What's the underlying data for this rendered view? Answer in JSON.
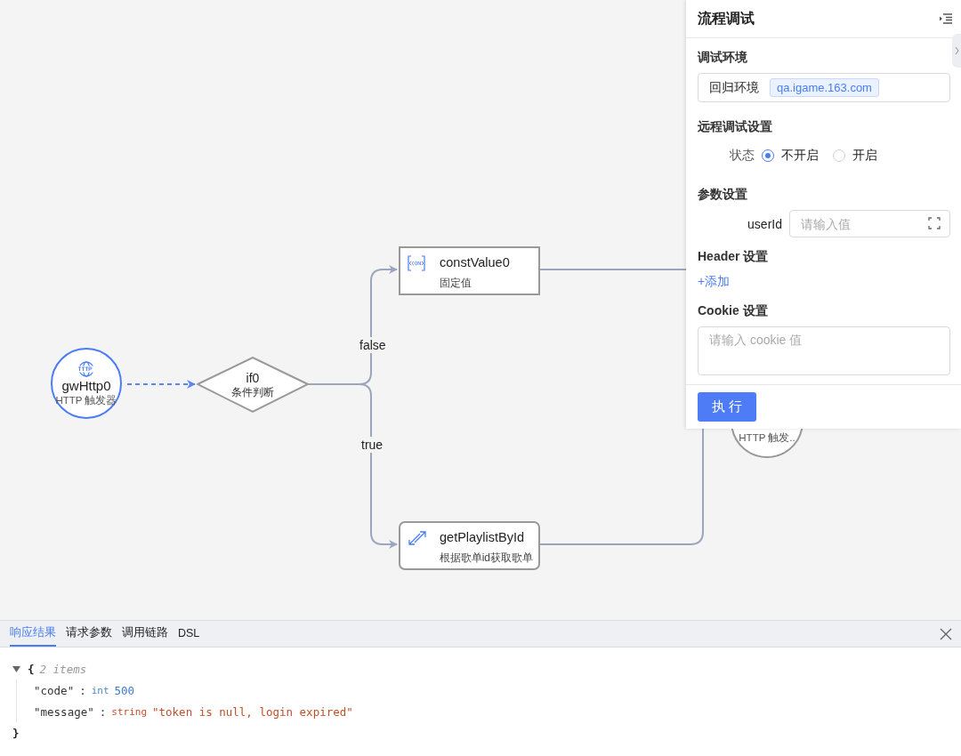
{
  "canvas": {
    "nodes": [
      {
        "kind": "trigger",
        "name": "gwHttp0",
        "subtitle": "HTTP 触发器",
        "selected": true
      },
      {
        "kind": "condition",
        "name": "if0",
        "subtitle": "条件判断",
        "selected": false
      },
      {
        "kind": "const",
        "name": "constValue0",
        "subtitle": "固定值",
        "selected": false
      },
      {
        "kind": "api",
        "name": "getPlaylistById",
        "subtitle": "根据歌单id获取歌单",
        "selected": false
      },
      {
        "kind": "trigger",
        "subtitle": "HTTP 触发..",
        "selected": false
      }
    ],
    "edge_labels": [
      "false",
      "true"
    ]
  },
  "debug_panel": {
    "title": "流程调试",
    "environment": {
      "label": "调试环境",
      "value": "回归环境",
      "host": "qa.igame.163.com"
    },
    "remote": {
      "label": "远程调试设置",
      "field_label": "状态",
      "options": [
        {
          "label": "不开启",
          "selected": true
        },
        {
          "label": "开启",
          "selected": false
        }
      ]
    },
    "params": {
      "label": "参数设置",
      "fields": [
        {
          "name": "userId",
          "placeholder": "请输入值"
        }
      ]
    },
    "header": {
      "label": "Header 设置",
      "add_link": "+添加"
    },
    "cookie": {
      "label": "Cookie 设置",
      "placeholder": "请输入 cookie 值"
    },
    "run_button": "执 行"
  },
  "result_panel": {
    "tabs": [
      {
        "label": "响应结果",
        "selected": true
      },
      {
        "label": "请求参数",
        "selected": false
      },
      {
        "label": "调用链路",
        "selected": false
      },
      {
        "label": "DSL",
        "selected": false
      }
    ],
    "json_viewer": {
      "open": "{",
      "summary": "2 items",
      "close": "}",
      "entries": [
        {
          "key": "\"code\"",
          "colon": ":",
          "type": "int",
          "value": "500"
        },
        {
          "key": "\"message\"",
          "colon": ":",
          "type": "string",
          "value": "\"token is null, login expired\""
        }
      ]
    }
  }
}
